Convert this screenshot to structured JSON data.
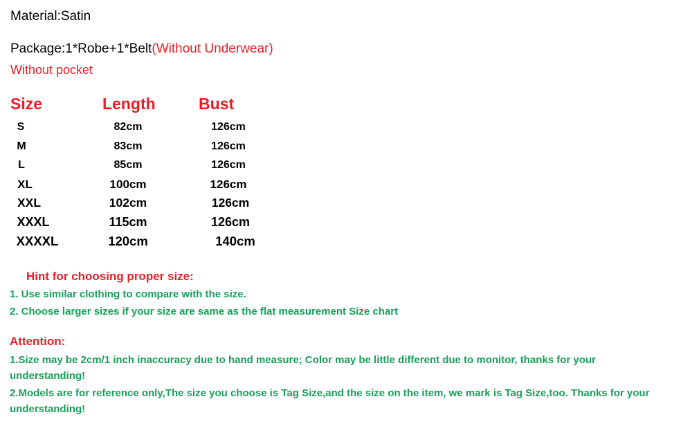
{
  "intro": {
    "material": "Material:Satin",
    "package_black": "Package:1*Robe+1*Belt",
    "package_red": "(Without Underwear)",
    "pocket": "Without pocket"
  },
  "size_chart": {
    "headers": [
      "Size",
      "Length",
      "Bust"
    ],
    "rows": [
      {
        "size": "S",
        "length": "82cm",
        "bust": "126cm"
      },
      {
        "size": "M",
        "length": "83cm",
        "bust": "126cm"
      },
      {
        "size": "L",
        "length": "85cm",
        "bust": "126cm"
      },
      {
        "size": "XL",
        "length": "100cm",
        "bust": "126cm"
      },
      {
        "size": "XXL",
        "length": "102cm",
        "bust": "126cm"
      },
      {
        "size": "XXXL",
        "length": "115cm",
        "bust": "126cm"
      },
      {
        "size": "XXXXL",
        "length": "120cm",
        "bust": "140cm"
      }
    ]
  },
  "hint": {
    "title": "Hint for choosing proper size:",
    "items": [
      "1. Use similar clothing to compare with the size.",
      "2. Choose larger sizes if your size are same as the flat measurement Size chart"
    ]
  },
  "attention": {
    "title": "Attention:",
    "items": [
      "1.Size may be 2cm/1 inch inaccuracy due to hand measure; Color may be little different   due to monitor, thanks for your understanding!",
      "2.Models are for reference only,The size you choose is Tag Size,and the size on the item,  we mark is Tag Size,too. Thanks for your understanding!"
    ]
  },
  "colors": {
    "red": "#ED1C24",
    "green": "#17A05B",
    "black": "#000000",
    "background": "#FFFFFF"
  }
}
